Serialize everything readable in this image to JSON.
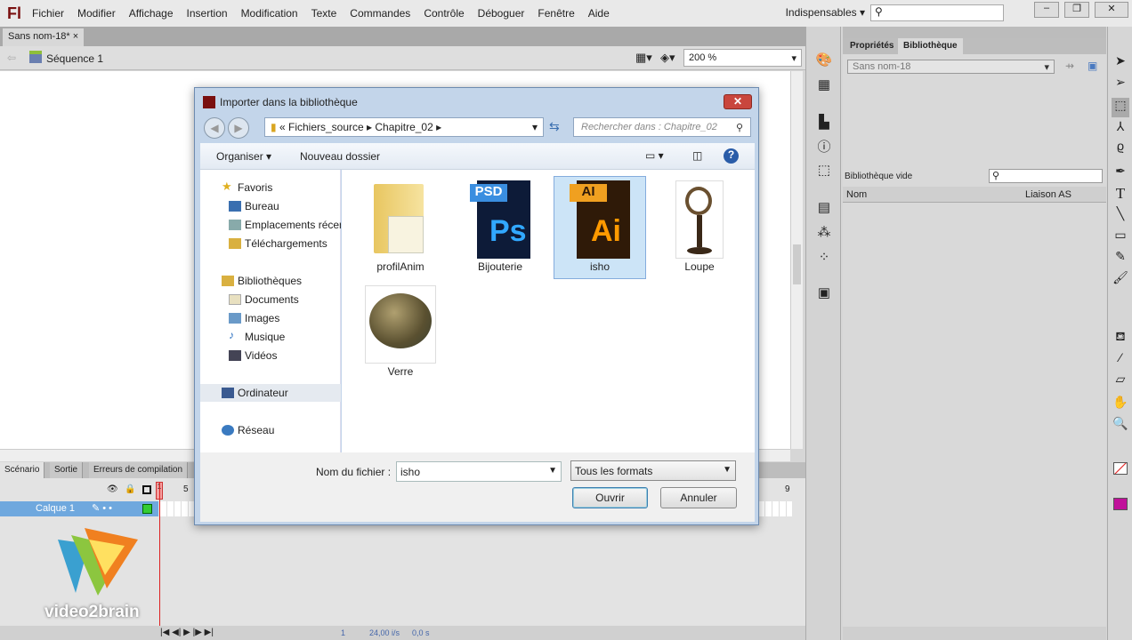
{
  "app": {
    "logo": "Fl",
    "menus": [
      "Fichier",
      "Modifier",
      "Affichage",
      "Insertion",
      "Modification",
      "Texte",
      "Commandes",
      "Contrôle",
      "Déboguer",
      "Fenêtre",
      "Aide"
    ],
    "workspace": "Indispensables",
    "search_icon": "search-icon"
  },
  "document": {
    "tab": "Sans nom-18*",
    "tab_close": "×",
    "sequence": "Séquence 1",
    "zoom": "200 %"
  },
  "timeline": {
    "tabs": [
      "Scénario",
      "Sortie",
      "Erreurs de compilation"
    ],
    "layer": "Calque 1",
    "frame_marks": [
      "1",
      "5",
      "9"
    ],
    "current_frame": "1",
    "fps": "24,00 i/s",
    "time": "0,0 s",
    "watermark": "video2brain"
  },
  "library": {
    "tabs": [
      "Propriétés",
      "Bibliothèque"
    ],
    "document": "Sans nom-18",
    "status": "Bibliothèque vide",
    "columns": [
      "Nom",
      "Liaison AS"
    ]
  },
  "dialog": {
    "title": "Importer dans la bibliothèque",
    "close": "✕",
    "path": [
      "«",
      "Fichiers_source",
      "Chapitre_02"
    ],
    "search_placeholder": "Rechercher dans : Chapitre_02",
    "organize": "Organiser ▾",
    "new_folder": "Nouveau dossier",
    "nav": {
      "favorites": "Favoris",
      "fav_items": [
        "Bureau",
        "Emplacements récents",
        "Téléchargements"
      ],
      "libraries": "Bibliothèques",
      "lib_items": [
        "Documents",
        "Images",
        "Musique",
        "Vidéos"
      ],
      "computer": "Ordinateur",
      "network": "Réseau"
    },
    "files": [
      {
        "name": "profilAnim",
        "type": "folder"
      },
      {
        "name": "Bijouterie",
        "type": "psd"
      },
      {
        "name": "isho",
        "type": "ai",
        "selected": true
      },
      {
        "name": "Loupe",
        "type": "image"
      },
      {
        "name": "Verre",
        "type": "image"
      }
    ],
    "filename_label": "Nom du fichier :",
    "filename": "isho",
    "filter": "Tous les formats",
    "open": "Ouvrir",
    "cancel": "Annuler"
  }
}
